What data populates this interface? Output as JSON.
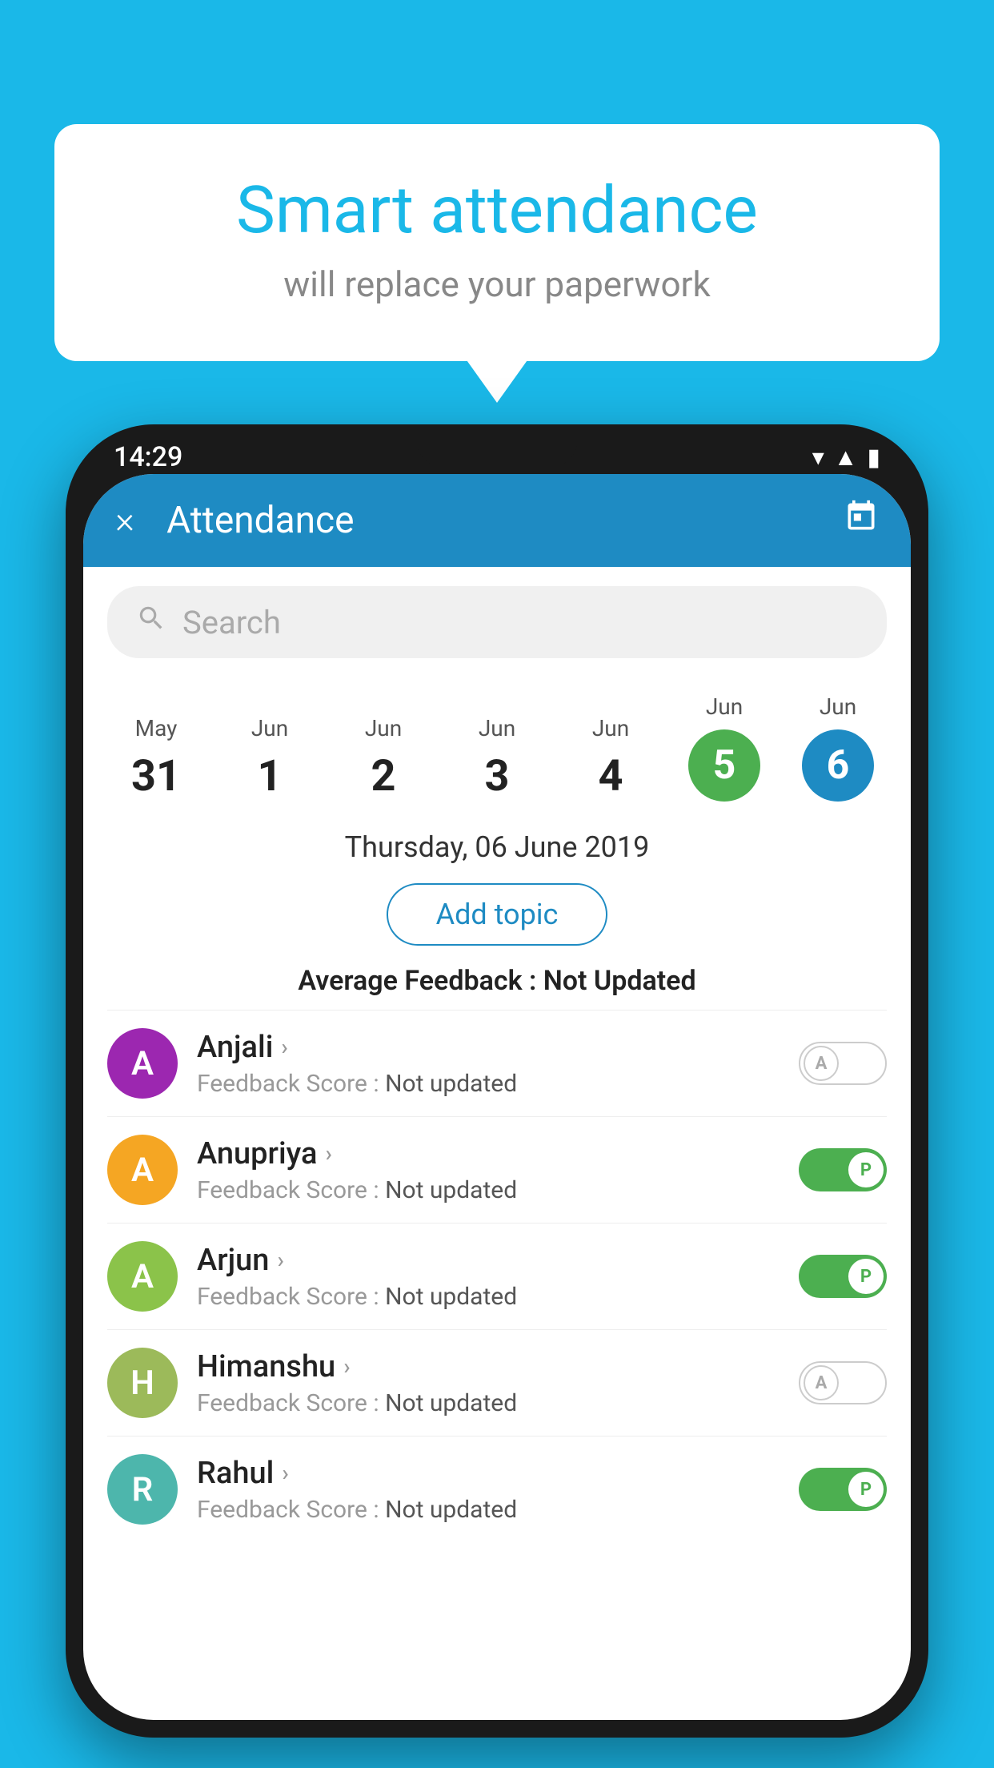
{
  "background_color": "#1ab8e8",
  "speech_bubble": {
    "title": "Smart attendance",
    "subtitle": "will replace your paperwork"
  },
  "status_bar": {
    "time": "14:29",
    "icons": [
      "wifi",
      "signal",
      "battery"
    ]
  },
  "app_bar": {
    "close_label": "×",
    "title": "Attendance",
    "calendar_icon": "calendar"
  },
  "search": {
    "placeholder": "Search"
  },
  "date_picker": {
    "dates": [
      {
        "month": "May",
        "day": "31",
        "selected": false
      },
      {
        "month": "Jun",
        "day": "1",
        "selected": false
      },
      {
        "month": "Jun",
        "day": "2",
        "selected": false
      },
      {
        "month": "Jun",
        "day": "3",
        "selected": false
      },
      {
        "month": "Jun",
        "day": "4",
        "selected": false
      },
      {
        "month": "Jun",
        "day": "5",
        "selected": "green"
      },
      {
        "month": "Jun",
        "day": "6",
        "selected": "blue"
      }
    ]
  },
  "selected_date": "Thursday, 06 June 2019",
  "add_topic_label": "Add topic",
  "average_feedback": {
    "label": "Average Feedback : ",
    "value": "Not Updated"
  },
  "students": [
    {
      "name": "Anjali",
      "avatar_letter": "A",
      "avatar_color": "purple",
      "feedback": "Feedback Score : Not updated",
      "toggle": "off",
      "toggle_letter": "A"
    },
    {
      "name": "Anupriya",
      "avatar_letter": "A",
      "avatar_color": "yellow",
      "feedback": "Feedback Score : Not updated",
      "toggle": "on",
      "toggle_letter": "P"
    },
    {
      "name": "Arjun",
      "avatar_letter": "A",
      "avatar_color": "green",
      "feedback": "Feedback Score : Not updated",
      "toggle": "on",
      "toggle_letter": "P"
    },
    {
      "name": "Himanshu",
      "avatar_letter": "H",
      "avatar_color": "olive",
      "feedback": "Feedback Score : Not updated",
      "toggle": "off",
      "toggle_letter": "A"
    },
    {
      "name": "Rahul",
      "avatar_letter": "R",
      "avatar_color": "teal",
      "feedback": "Feedback Score : Not updated",
      "toggle": "on",
      "toggle_letter": "P"
    }
  ]
}
